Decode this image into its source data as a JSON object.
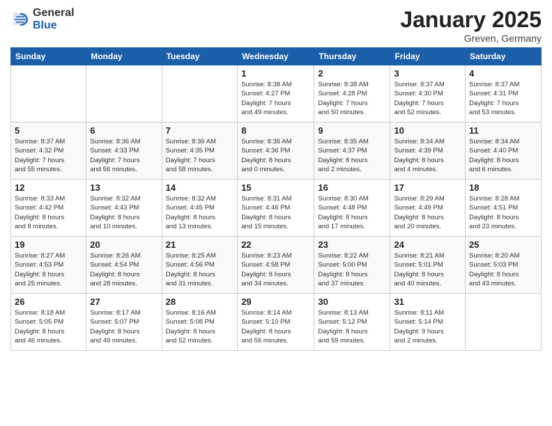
{
  "logo": {
    "general": "General",
    "blue": "Blue"
  },
  "header": {
    "month": "January 2025",
    "location": "Greven, Germany"
  },
  "weekdays": [
    "Sunday",
    "Monday",
    "Tuesday",
    "Wednesday",
    "Thursday",
    "Friday",
    "Saturday"
  ],
  "weeks": [
    [
      {
        "day": "",
        "info": ""
      },
      {
        "day": "",
        "info": ""
      },
      {
        "day": "",
        "info": ""
      },
      {
        "day": "1",
        "info": "Sunrise: 8:38 AM\nSunset: 4:27 PM\nDaylight: 7 hours\nand 49 minutes."
      },
      {
        "day": "2",
        "info": "Sunrise: 8:38 AM\nSunset: 4:28 PM\nDaylight: 7 hours\nand 50 minutes."
      },
      {
        "day": "3",
        "info": "Sunrise: 8:37 AM\nSunset: 4:30 PM\nDaylight: 7 hours\nand 52 minutes."
      },
      {
        "day": "4",
        "info": "Sunrise: 8:37 AM\nSunset: 4:31 PM\nDaylight: 7 hours\nand 53 minutes."
      }
    ],
    [
      {
        "day": "5",
        "info": "Sunrise: 8:37 AM\nSunset: 4:32 PM\nDaylight: 7 hours\nand 55 minutes."
      },
      {
        "day": "6",
        "info": "Sunrise: 8:36 AM\nSunset: 4:33 PM\nDaylight: 7 hours\nand 56 minutes."
      },
      {
        "day": "7",
        "info": "Sunrise: 8:36 AM\nSunset: 4:35 PM\nDaylight: 7 hours\nand 58 minutes."
      },
      {
        "day": "8",
        "info": "Sunrise: 8:36 AM\nSunset: 4:36 PM\nDaylight: 8 hours\nand 0 minutes."
      },
      {
        "day": "9",
        "info": "Sunrise: 8:35 AM\nSunset: 4:37 PM\nDaylight: 8 hours\nand 2 minutes."
      },
      {
        "day": "10",
        "info": "Sunrise: 8:34 AM\nSunset: 4:39 PM\nDaylight: 8 hours\nand 4 minutes."
      },
      {
        "day": "11",
        "info": "Sunrise: 8:34 AM\nSunset: 4:40 PM\nDaylight: 8 hours\nand 6 minutes."
      }
    ],
    [
      {
        "day": "12",
        "info": "Sunrise: 8:33 AM\nSunset: 4:42 PM\nDaylight: 8 hours\nand 8 minutes."
      },
      {
        "day": "13",
        "info": "Sunrise: 8:32 AM\nSunset: 4:43 PM\nDaylight: 8 hours\nand 10 minutes."
      },
      {
        "day": "14",
        "info": "Sunrise: 8:32 AM\nSunset: 4:45 PM\nDaylight: 8 hours\nand 13 minutes."
      },
      {
        "day": "15",
        "info": "Sunrise: 8:31 AM\nSunset: 4:46 PM\nDaylight: 8 hours\nand 15 minutes."
      },
      {
        "day": "16",
        "info": "Sunrise: 8:30 AM\nSunset: 4:48 PM\nDaylight: 8 hours\nand 17 minutes."
      },
      {
        "day": "17",
        "info": "Sunrise: 8:29 AM\nSunset: 4:49 PM\nDaylight: 8 hours\nand 20 minutes."
      },
      {
        "day": "18",
        "info": "Sunrise: 8:28 AM\nSunset: 4:51 PM\nDaylight: 8 hours\nand 23 minutes."
      }
    ],
    [
      {
        "day": "19",
        "info": "Sunrise: 8:27 AM\nSunset: 4:53 PM\nDaylight: 8 hours\nand 25 minutes."
      },
      {
        "day": "20",
        "info": "Sunrise: 8:26 AM\nSunset: 4:54 PM\nDaylight: 8 hours\nand 28 minutes."
      },
      {
        "day": "21",
        "info": "Sunrise: 8:25 AM\nSunset: 4:56 PM\nDaylight: 8 hours\nand 31 minutes."
      },
      {
        "day": "22",
        "info": "Sunrise: 8:23 AM\nSunset: 4:58 PM\nDaylight: 8 hours\nand 34 minutes."
      },
      {
        "day": "23",
        "info": "Sunrise: 8:22 AM\nSunset: 5:00 PM\nDaylight: 8 hours\nand 37 minutes."
      },
      {
        "day": "24",
        "info": "Sunrise: 8:21 AM\nSunset: 5:01 PM\nDaylight: 8 hours\nand 40 minutes."
      },
      {
        "day": "25",
        "info": "Sunrise: 8:20 AM\nSunset: 5:03 PM\nDaylight: 8 hours\nand 43 minutes."
      }
    ],
    [
      {
        "day": "26",
        "info": "Sunrise: 8:18 AM\nSunset: 5:05 PM\nDaylight: 8 hours\nand 46 minutes."
      },
      {
        "day": "27",
        "info": "Sunrise: 8:17 AM\nSunset: 5:07 PM\nDaylight: 8 hours\nand 49 minutes."
      },
      {
        "day": "28",
        "info": "Sunrise: 8:16 AM\nSunset: 5:08 PM\nDaylight: 8 hours\nand 52 minutes."
      },
      {
        "day": "29",
        "info": "Sunrise: 8:14 AM\nSunset: 5:10 PM\nDaylight: 8 hours\nand 56 minutes."
      },
      {
        "day": "30",
        "info": "Sunrise: 8:13 AM\nSunset: 5:12 PM\nDaylight: 8 hours\nand 59 minutes."
      },
      {
        "day": "31",
        "info": "Sunrise: 8:11 AM\nSunset: 5:14 PM\nDaylight: 9 hours\nand 2 minutes."
      },
      {
        "day": "",
        "info": ""
      }
    ]
  ]
}
